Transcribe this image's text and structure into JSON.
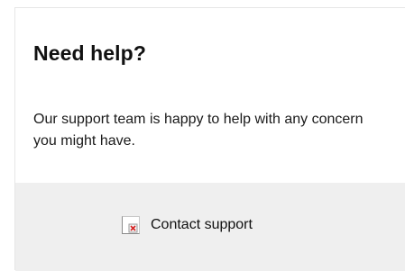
{
  "help_card": {
    "title": "Need help?",
    "description": "Our support team is happy to help with any concern you might have.",
    "contact": {
      "label": "Contact support",
      "icon": "broken-image-icon"
    }
  }
}
